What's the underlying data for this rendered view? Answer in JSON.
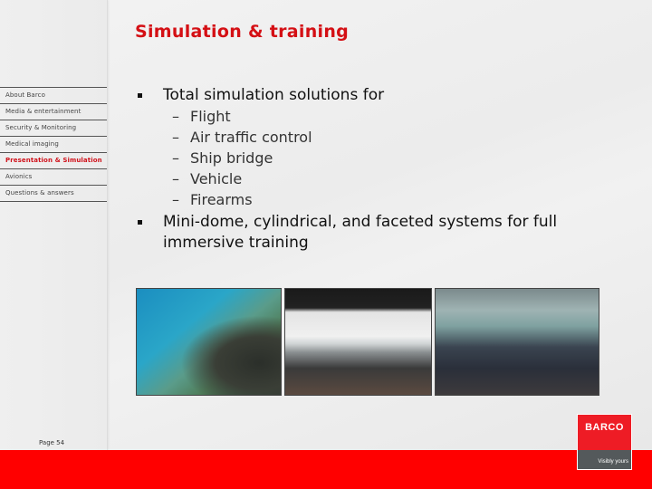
{
  "slide": {
    "title": "Simulation & training",
    "page_number": "Page 54"
  },
  "sidebar": {
    "items": [
      {
        "label": "About Barco",
        "active": false
      },
      {
        "label": "Media & entertainment",
        "active": false
      },
      {
        "label": "Security & Monitoring",
        "active": false
      },
      {
        "label": "Medical imaging",
        "active": false
      },
      {
        "label": "Presentation & Simulation",
        "active": true
      },
      {
        "label": "Avionics",
        "active": false
      },
      {
        "label": "Questions & answers",
        "active": false
      }
    ]
  },
  "content": {
    "bullets": [
      {
        "text": "Total simulation solutions for",
        "sub_items": [
          "Flight",
          "Air traffic control",
          "Ship bridge",
          "Vehicle",
          "Firearms"
        ]
      },
      {
        "text": "Mini-dome, cylindrical, and faceted systems for full immersive training",
        "sub_items": []
      }
    ],
    "photos": [
      {
        "alt": "Flight simulator dome with pilot in cockpit"
      },
      {
        "alt": "Ship bridge / control simulator with operators"
      },
      {
        "alt": "Naval bridge training room with trainees"
      }
    ]
  },
  "branding": {
    "logo_text": "BARCO",
    "tagline": "Visibly yours",
    "accent_color": "#d40f14",
    "footer_color": "#ff0000"
  },
  "symbols": {
    "dash": "–"
  }
}
